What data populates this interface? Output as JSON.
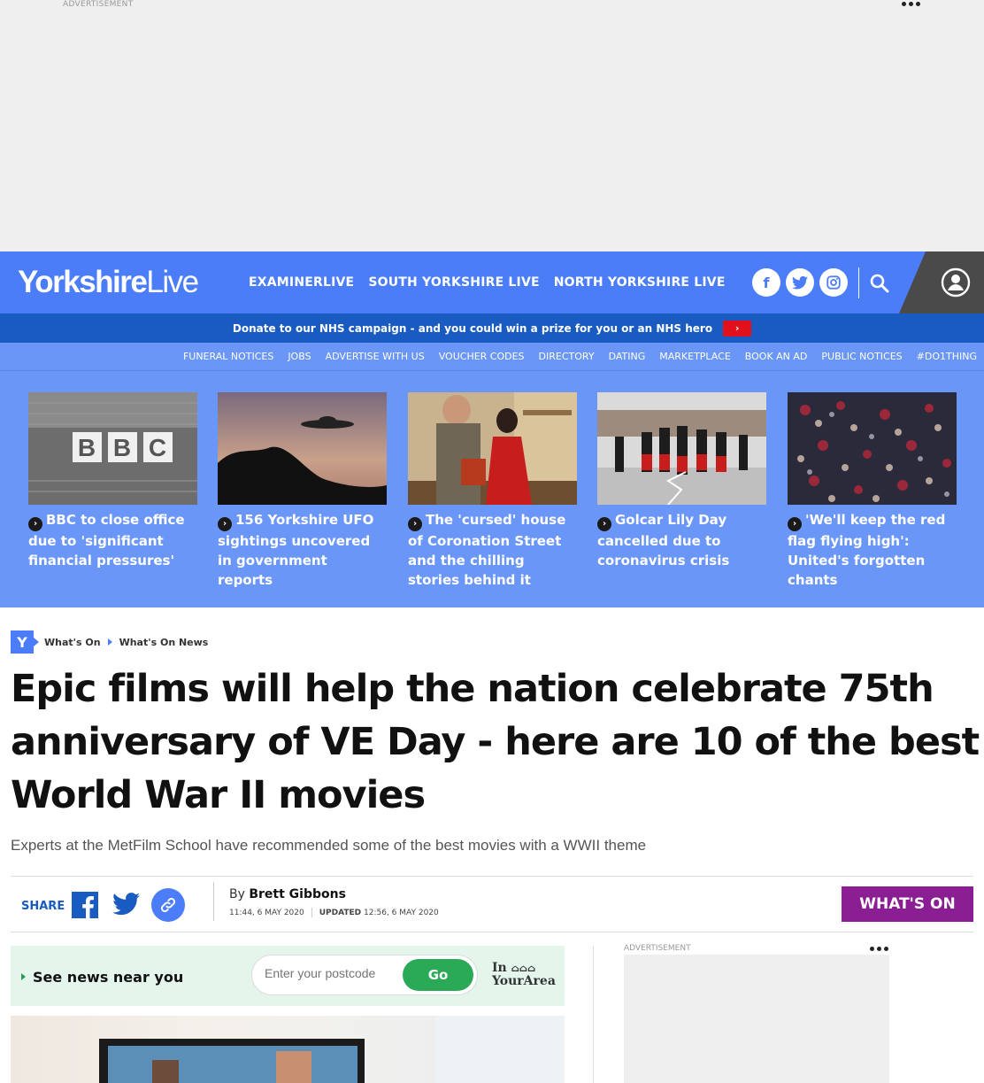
{
  "ad": {
    "label": "ADVERTISEMENT",
    "side_label": "ADVERTISEMENT"
  },
  "header": {
    "logo_bold": "Yorkshire",
    "logo_light": "Live",
    "nav": [
      "EXAMINERLIVE",
      "SOUTH YORKSHIRE LIVE",
      "NORTH YORKSHIRE LIVE"
    ]
  },
  "donate": {
    "text": "Donate to our NHS campaign - and you could win a prize for you or an NHS hero",
    "arrow": "›"
  },
  "subnav": [
    "FUNERAL NOTICES",
    "JOBS",
    "ADVERTISE WITH US",
    "VOUCHER CODES",
    "DIRECTORY",
    "DATING",
    "MARKETPLACE",
    "BOOK AN AD",
    "PUBLIC NOTICES",
    "#DO1THING"
  ],
  "teasers": [
    {
      "title": "BBC to close office due to 'significant financial pressures'",
      "sign": "BBC"
    },
    {
      "title": "156 Yorkshire UFO sightings uncovered in government reports"
    },
    {
      "title": "The 'cursed' house of Coronation Street and the chilling stories behind it"
    },
    {
      "title": "Golcar Lily Day cancelled due to coronavirus crisis"
    },
    {
      "title": "'We'll keep the red flag flying high': United's forgotten chants"
    }
  ],
  "breadcrumb": {
    "logo": "Y",
    "items": [
      "What's On",
      "What's On News"
    ]
  },
  "article": {
    "headline": "Epic films will help the nation celebrate 75th anniversary of VE Day - here are 10 of the best World War II movies",
    "standfirst": "Experts at the MetFilm School have recommended some of the best movies with a WWII theme",
    "share_label": "SHARE",
    "by": "By",
    "author": "Brett Gibbons",
    "published": "11:44, 6 MAY 2020",
    "updated_label": "UPDATED",
    "updated": "12:56, 6 MAY 2020",
    "section_button": "WHAT'S ON"
  },
  "near_you": {
    "label": "See news near you",
    "placeholder": "Enter your postcode",
    "go": "Go",
    "brand_line1": "In",
    "brand_line2": "YourArea"
  },
  "colors": {
    "brand": "#4a7df7",
    "donate": "#1a5bc2",
    "whats_on": "#8a1e92",
    "go": "#2aa957"
  }
}
